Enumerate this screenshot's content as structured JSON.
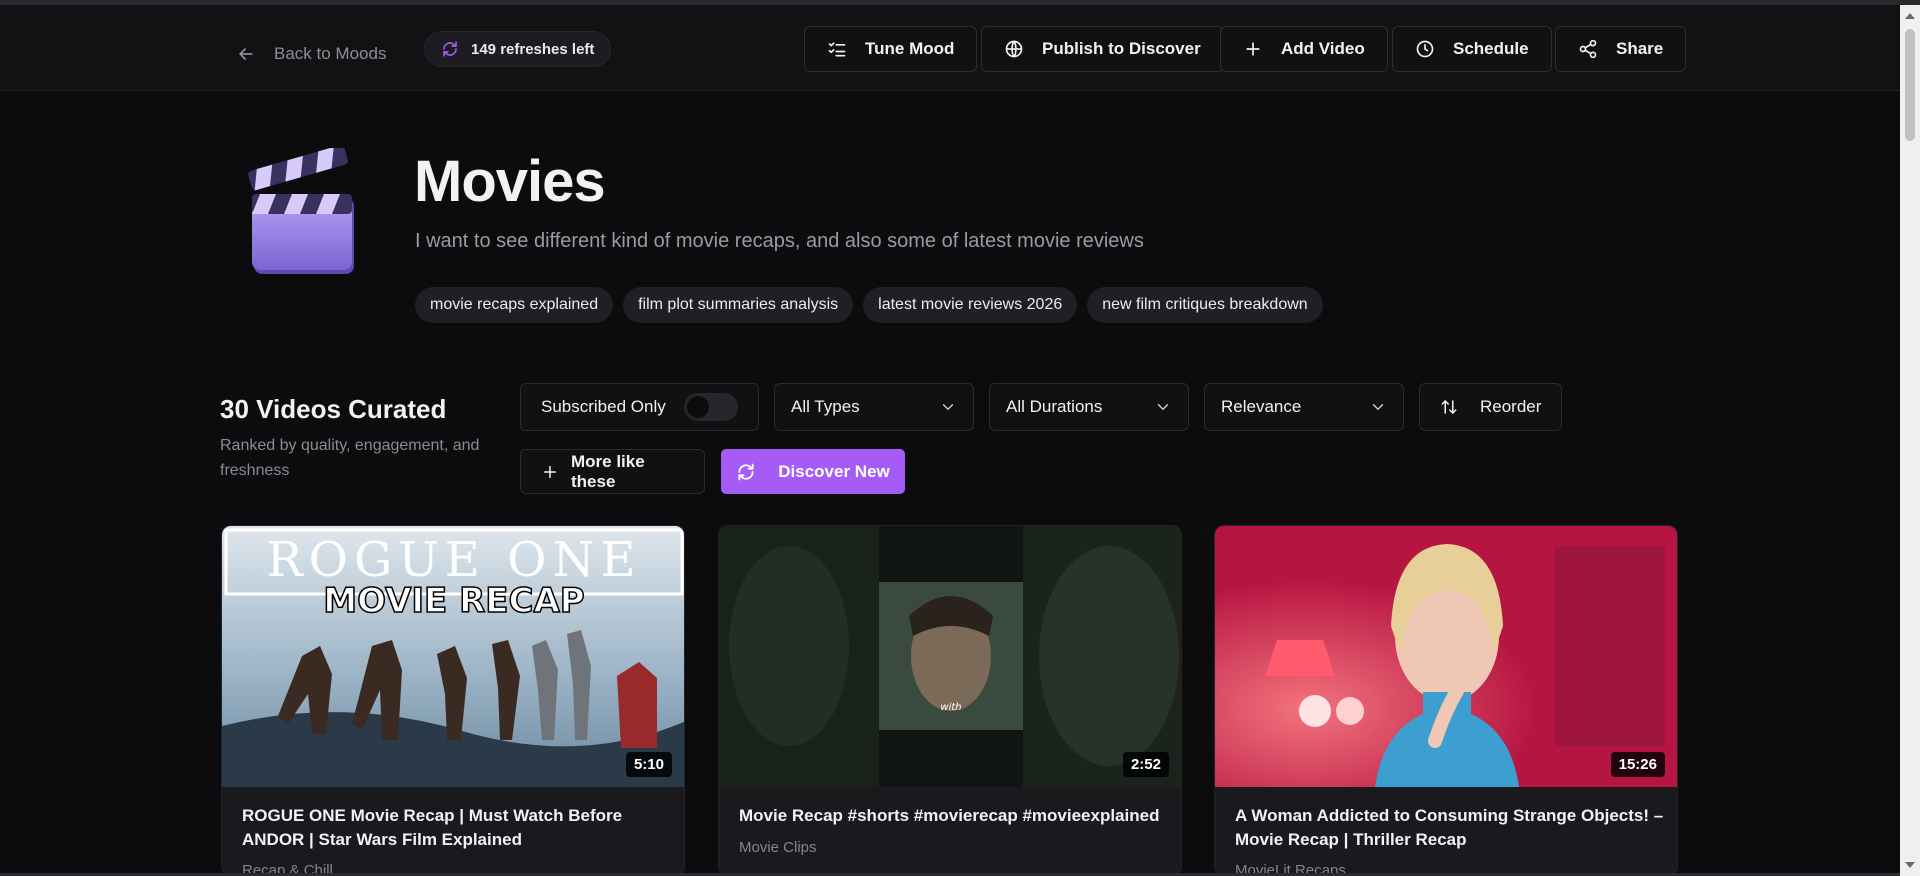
{
  "header": {
    "back_label": "Back to Moods",
    "refreshes_label": "149 refreshes left",
    "buttons": {
      "tune_mood": "Tune Mood",
      "publish": "Publish to Discover",
      "add_video": "Add Video",
      "schedule": "Schedule",
      "share": "Share"
    }
  },
  "mood": {
    "icon": "clapperboard-icon",
    "title": "Movies",
    "description": "I want to see different kind of movie recaps, and also some of latest movie reviews",
    "tags": [
      "movie recaps explained",
      "film plot summaries analysis",
      "latest movie reviews 2026",
      "new film critiques breakdown"
    ]
  },
  "videos_section": {
    "count_label": "30 Videos Curated",
    "subtitle": "Ranked by quality, engagement, and freshness",
    "controls": {
      "subscribed_only": "Subscribed Only",
      "subscribed_on": false,
      "type_select": "All Types",
      "duration_select": "All Durations",
      "sort_select": "Relevance",
      "reorder": "Reorder",
      "more_like": "More like these",
      "discover_new": "Discover New"
    }
  },
  "videos": [
    {
      "thumb_line1": "ROGUE ONE",
      "thumb_line2": "MOVIE RECAP",
      "duration": "5:10",
      "title": "ROGUE ONE Movie Recap | Must Watch Before ANDOR | Star Wars Film Explained",
      "channel": "Recap & Chill"
    },
    {
      "thumb_caption": "with",
      "duration": "2:52",
      "title": "Movie Recap #shorts #movierecap #movieexplained",
      "channel": "Movie Clips"
    },
    {
      "duration": "15:26",
      "title": "A Woman Addicted to Consuming Strange Objects! – Movie Recap | Thriller Recap",
      "channel": "MovieLit Recaps"
    }
  ],
  "colors": {
    "accent": "#a55bf5",
    "background": "#0c0c0e",
    "card": "#1a1a1e"
  }
}
